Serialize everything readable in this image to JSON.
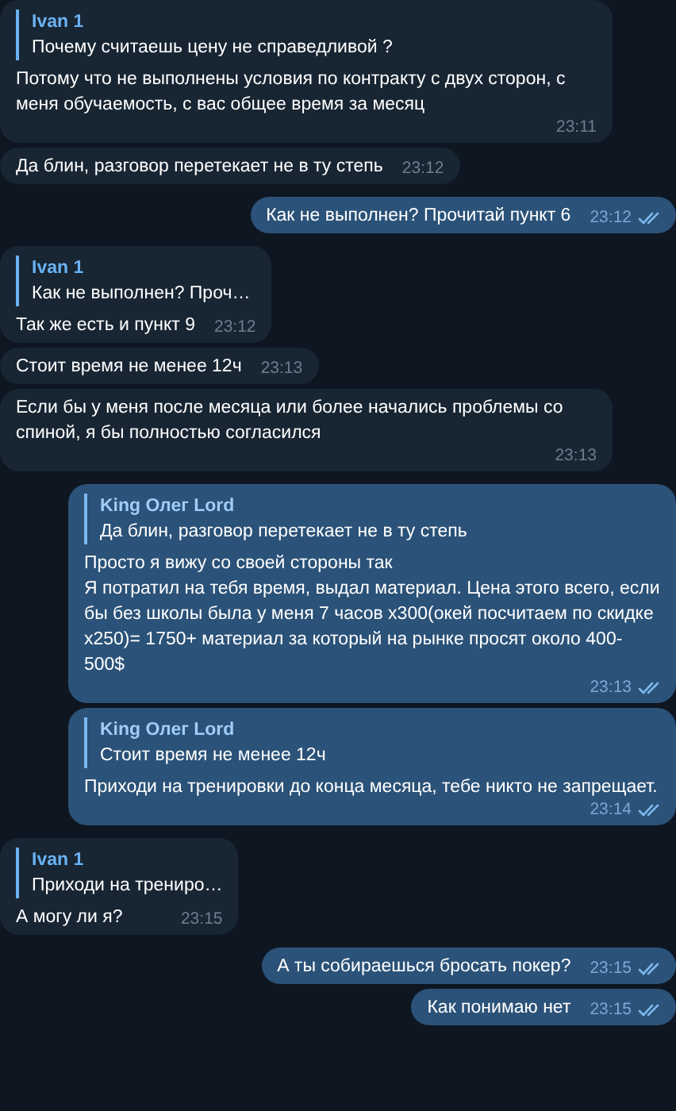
{
  "messages": [
    {
      "outgoing": false,
      "reply": {
        "author": "Ivan 1",
        "text": "Почему считаешь цену не справедливой ?"
      },
      "text": "Потому что не выполнены условия по контракту с двух сторон, с меня обучаемость, с вас общее время за месяц",
      "time": "23:11"
    },
    {
      "outgoing": false,
      "text": "Да блин, разговор перетекает не в ту степь",
      "time": "23:12"
    },
    {
      "outgoing": true,
      "text": "Как не выполнен? Прочитай пункт 6",
      "time": "23:12",
      "read": true
    },
    {
      "outgoing": false,
      "reply": {
        "author": "Ivan 1",
        "text": "Как не выполнен? Проч…"
      },
      "text": "Так же есть и пункт 9",
      "time": "23:12"
    },
    {
      "outgoing": false,
      "text": "Стоит время не менее 12ч",
      "time": "23:13"
    },
    {
      "outgoing": false,
      "text": "Если бы у меня после месяца или более начались проблемы со спиной, я бы полностью согласился",
      "time": "23:13"
    },
    {
      "outgoing": true,
      "reply": {
        "author": "King Олег Lord",
        "text": "Да блин, разговор перетекает не в ту степь"
      },
      "text": "Просто я вижу со своей стороны так\nЯ потратил на тебя время, выдал материал. Цена этого всего, если бы без школы была у меня 7 часов x300(окей посчитаем по скидке x250)= 1750+ материал за который на рынке просят около 400-500$",
      "time": "23:13",
      "read": true
    },
    {
      "outgoing": true,
      "reply": {
        "author": "King Олег Lord",
        "text": "Стоит время не менее 12ч"
      },
      "text": "Приходи на тренировки до конца месяца, тебе никто не запрещает.",
      "time": "23:14",
      "read": true
    },
    {
      "outgoing": false,
      "reply": {
        "author": "Ivan 1",
        "text": "Приходи на трениро…"
      },
      "text": "А могу ли я?",
      "time": "23:15"
    },
    {
      "outgoing": true,
      "text": "А ты собираешься бросать покер?",
      "time": "23:15",
      "read": true
    },
    {
      "outgoing": true,
      "text": "Как понимаю нет",
      "time": "23:15",
      "read": true
    }
  ]
}
